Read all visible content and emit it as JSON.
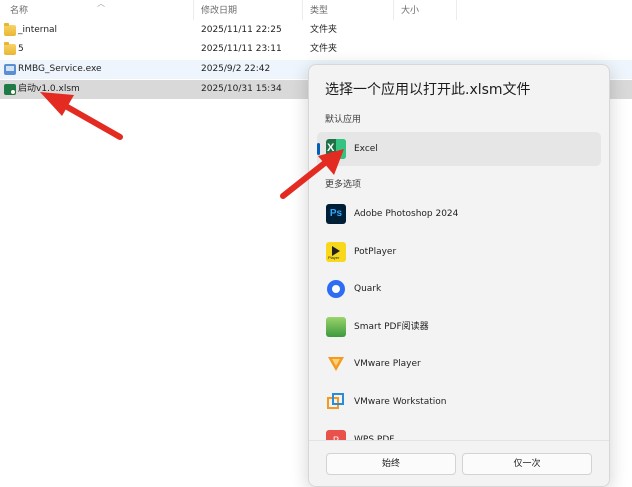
{
  "columns": {
    "name": "名称",
    "modified": "修改日期",
    "type": "类型",
    "size": "大小"
  },
  "files": [
    {
      "name": "_internal",
      "modified": "2025/11/11 22:25",
      "type": "文件夹",
      "size": "",
      "icon": "folder-icon"
    },
    {
      "name": "5",
      "modified": "2025/11/11 23:11",
      "type": "文件夹",
      "size": "",
      "icon": "folder-icon"
    },
    {
      "name": "RMBG_Service.exe",
      "modified": "2025/9/2 22:42",
      "type": "",
      "size": "",
      "icon": "exe-icon"
    },
    {
      "name": "启动v1.0.xlsm",
      "modified": "2025/10/31 15:34",
      "type": "",
      "size": "",
      "icon": "xlsm-icon",
      "selected": true
    }
  ],
  "dialog": {
    "title": "选择一个应用以打开此.xlsm文件",
    "default_label": "默认应用",
    "more_label": "更多选项",
    "default_app": {
      "name": "Excel",
      "icon": "excel-icon"
    },
    "apps": [
      {
        "name": "Adobe Photoshop 2024",
        "icon": "photoshop-icon",
        "icon_text": "Ps"
      },
      {
        "name": "PotPlayer",
        "icon": "potplayer-icon"
      },
      {
        "name": "Quark",
        "icon": "quark-icon"
      },
      {
        "name": "Smart PDF阅读器",
        "icon": "smart-pdf-icon"
      },
      {
        "name": "VMware Player",
        "icon": "vmware-player-icon"
      },
      {
        "name": "VMware Workstation",
        "icon": "vmware-workstation-icon"
      },
      {
        "name": "WPS PDF",
        "icon": "wps-pdf-icon",
        "icon_text": "P"
      }
    ],
    "always_button": "始终",
    "once_button": "仅一次"
  },
  "colors": {
    "accent": "#005fb8",
    "annotation_arrow": "#e32b22"
  }
}
